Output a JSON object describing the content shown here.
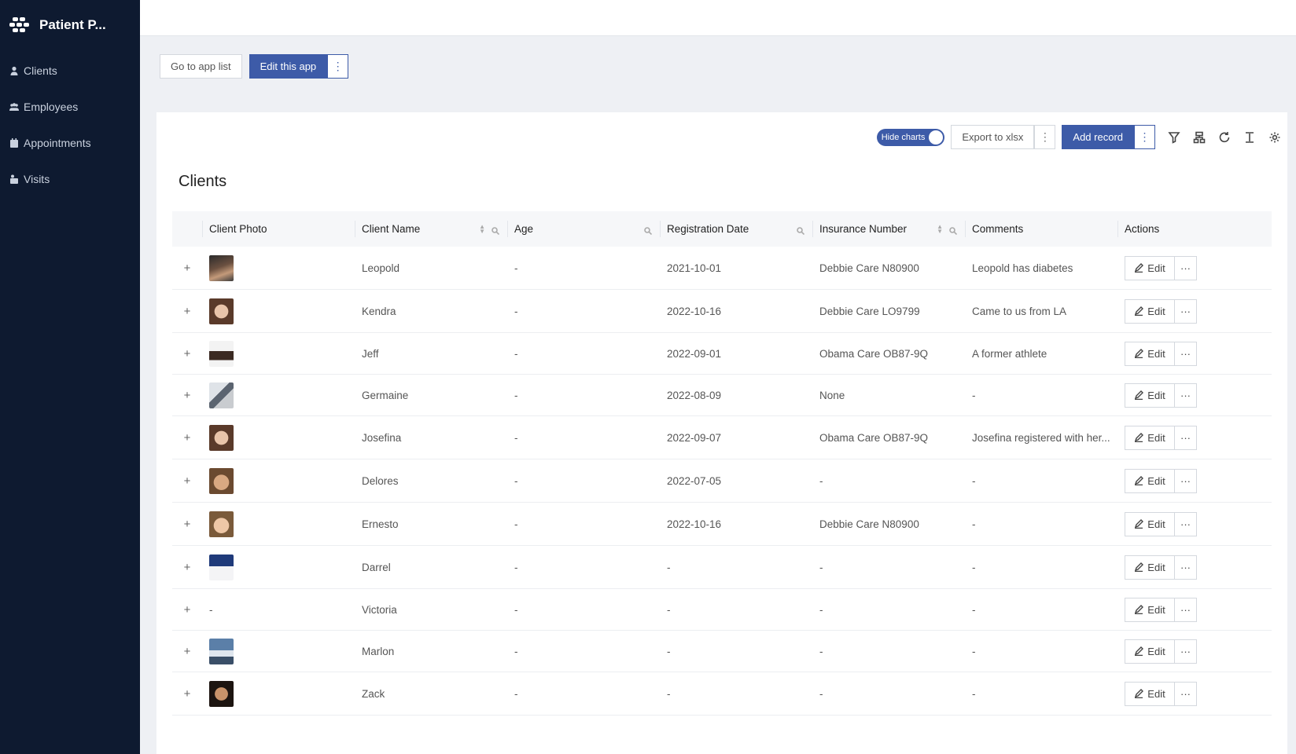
{
  "app": {
    "title": "Patient P..."
  },
  "sidebar": {
    "items": [
      {
        "label": "Clients",
        "icon": "user-icon"
      },
      {
        "label": "Employees",
        "icon": "users-icon"
      },
      {
        "label": "Appointments",
        "icon": "calendar-icon"
      },
      {
        "label": "Visits",
        "icon": "visit-icon"
      }
    ]
  },
  "app_buttons": {
    "go_to_app_list": "Go to app list",
    "edit_this_app": "Edit this app",
    "more": "⋮"
  },
  "toolbar": {
    "hide_charts": "Hide charts",
    "export": "Export to xlsx",
    "add_record": "Add record",
    "more": "⋮",
    "icons": [
      "filter-icon",
      "hierarchy-icon",
      "refresh-icon",
      "row-height-icon",
      "settings-icon"
    ]
  },
  "page": {
    "title": "Clients"
  },
  "table": {
    "columns": [
      "Client Photo",
      "Client Name",
      "Age",
      "Registration Date",
      "Insurance Number",
      "Comments",
      "Actions"
    ],
    "edit_label": "Edit",
    "more_label": "···",
    "expand_label": "+",
    "rows": [
      {
        "photo": "photo-man",
        "name": "Leopold",
        "age": "-",
        "date": "2021-10-01",
        "insurance": "Debbie Care N80900",
        "comments": "Leopold has diabetes"
      },
      {
        "photo": "photo-woman",
        "name": "Kendra",
        "age": "-",
        "date": "2022-10-16",
        "insurance": "Debbie Care LO9799",
        "comments": "Came to us from LA"
      },
      {
        "photo": "photo-athlete",
        "name": "Jeff",
        "age": "-",
        "date": "2022-09-01",
        "insurance": "Obama Care OB87-9Q",
        "comments": "A former athlete"
      },
      {
        "photo": "photo-scene",
        "name": "Germaine",
        "age": "-",
        "date": "2022-08-09",
        "insurance": "None",
        "comments": "-"
      },
      {
        "photo": "photo-woman",
        "name": "Josefina",
        "age": "-",
        "date": "2022-09-07",
        "insurance": "Obama Care OB87-9Q",
        "comments": "Josefina registered with her..."
      },
      {
        "photo": "photo-man-smile",
        "name": "Delores",
        "age": "-",
        "date": "2022-07-05",
        "insurance": "-",
        "comments": "-"
      },
      {
        "photo": "photo-boy",
        "name": "Ernesto",
        "age": "-",
        "date": "2022-10-16",
        "insurance": "Debbie Care N80900",
        "comments": "-"
      },
      {
        "photo": "photo-screenshot",
        "name": "Darrel",
        "age": "-",
        "date": "-",
        "insurance": "-",
        "comments": "-"
      },
      {
        "photo": null,
        "photo_text": "-",
        "name": "Victoria",
        "age": "-",
        "date": "-",
        "insurance": "-",
        "comments": "-"
      },
      {
        "photo": "photo-landscape",
        "name": "Marlon",
        "age": "-",
        "date": "-",
        "insurance": "-",
        "comments": "-"
      },
      {
        "photo": "photo-man-beard",
        "name": "Zack",
        "age": "-",
        "date": "-",
        "insurance": "-",
        "comments": "-"
      }
    ]
  },
  "colors": {
    "sidebar_bg": "#0e1a30",
    "primary": "#3d5ba8",
    "page_bg": "#eef0f4"
  }
}
